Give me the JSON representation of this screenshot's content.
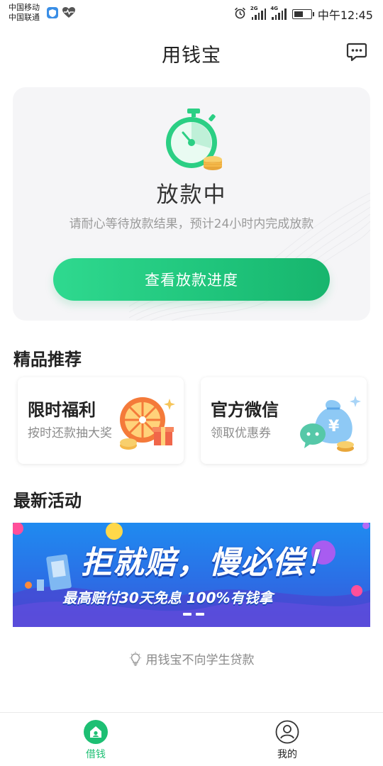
{
  "status_bar": {
    "carrier_1": "中国移动",
    "carrier_2": "中国联通",
    "network_1": "2G",
    "network_2": "4G",
    "time": "中午12:45"
  },
  "header": {
    "title": "用钱宝"
  },
  "loan_card": {
    "status": "放款中",
    "description": "请耐心等待放款结果，预计24小时内完成放款",
    "button_label": "查看放款进度"
  },
  "recommend": {
    "section_title": "精品推荐",
    "items": [
      {
        "title": "限时福利",
        "subtitle": "按时还款抽大奖"
      },
      {
        "title": "官方微信",
        "subtitle": "领取优惠券"
      }
    ]
  },
  "activity": {
    "section_title": "最新活动",
    "banner_headline": "拒就赔，慢必偿！",
    "banner_sub": "最高赔付30天免息 100%有钱拿"
  },
  "notice": {
    "text": "用钱宝不向学生贷款"
  },
  "tab_bar": {
    "active_color": "#1dbf73",
    "tabs": [
      {
        "label": "借钱",
        "icon": "house-icon"
      },
      {
        "label": "我的",
        "icon": "user-icon"
      }
    ]
  }
}
